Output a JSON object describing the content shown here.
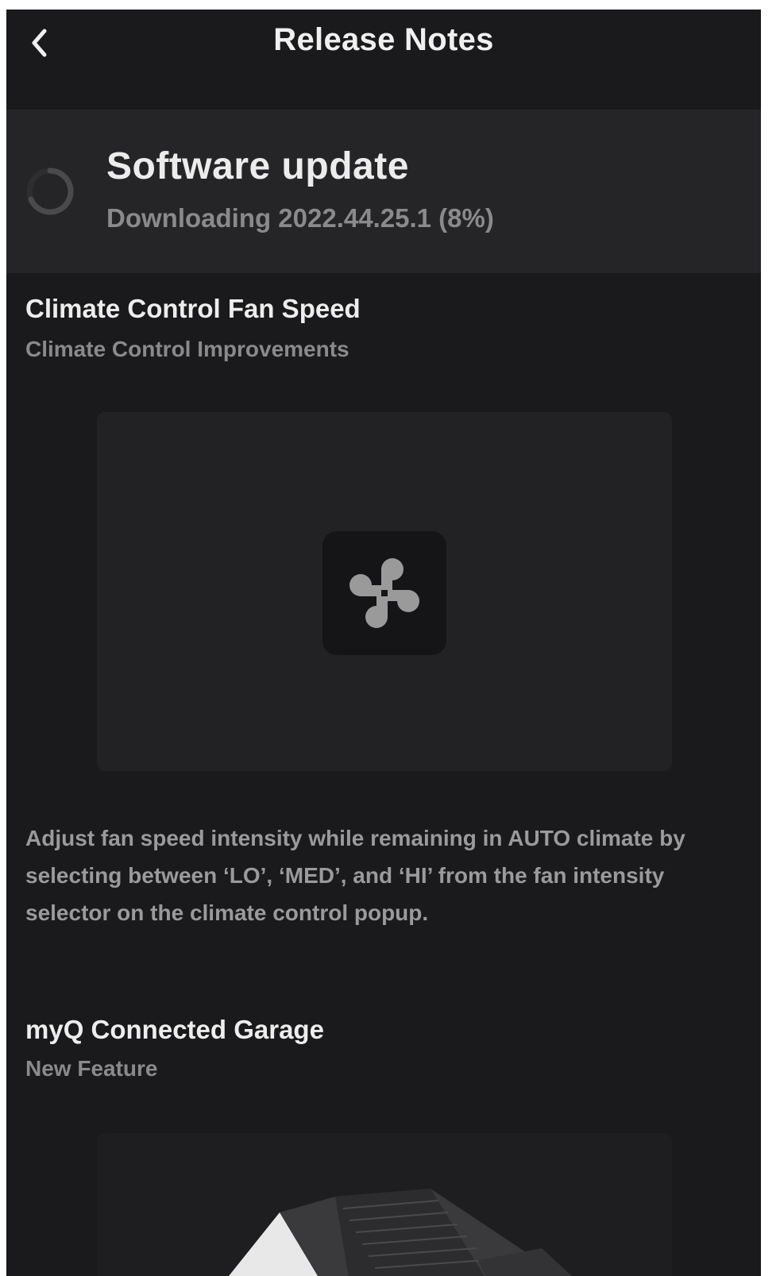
{
  "header": {
    "title": "Release Notes",
    "back_icon": "chevron-left-icon"
  },
  "update": {
    "title": "Software update",
    "status": "Downloading 2022.44.25.1 (8%)",
    "progress_percent": 8,
    "spinner_icon": "loading-spinner-icon"
  },
  "notes": [
    {
      "title": "Climate Control Fan Speed",
      "subtitle": "Climate Control Improvements",
      "icon": "fan-icon",
      "description": "Adjust fan speed intensity while remaining in AUTO climate by selecting between ‘LO’, ‘MED’, and ‘HI’ from the fan intensity selector on the climate control popup."
    },
    {
      "title": "myQ Connected Garage",
      "subtitle": "New Feature",
      "icon": "garage-house-image"
    }
  ],
  "colors": {
    "background": "#1a1a1c",
    "banner": "#252527",
    "card": "#222224",
    "title_text": "#ededed",
    "muted_text": "#8a8a8c",
    "icon_fill": "#9a9a9a"
  }
}
